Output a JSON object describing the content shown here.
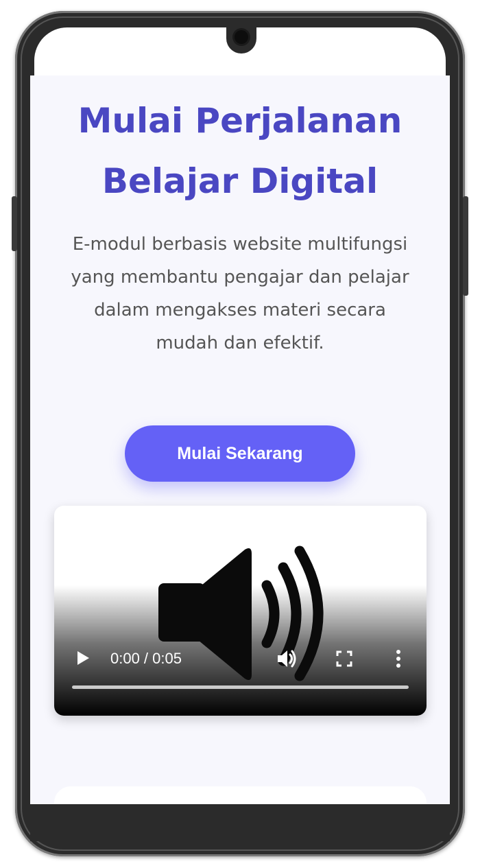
{
  "hero": {
    "title_line1": "Mulai Perjalanan",
    "title_line2": "Belajar Digital",
    "description": "E-modul berbasis website multifungsi yang membantu pengajar dan pelajar dalam mengakses materi secara mudah dan efektif.",
    "cta_label": "Mulai Sekarang"
  },
  "video": {
    "time_display": "0:00 / 0:05",
    "poster_icon": "speaker-volume-icon",
    "progress": 0
  },
  "colors": {
    "title": "#4a47c2",
    "cta": "#6461f6",
    "page_bg": "#f7f7fd",
    "text": "#555555"
  }
}
